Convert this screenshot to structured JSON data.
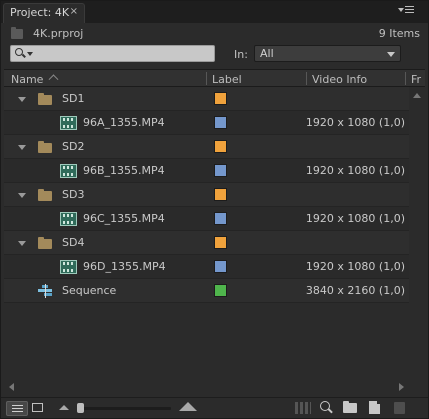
{
  "tab": {
    "title": "Project: 4K",
    "close": "×"
  },
  "project": {
    "filename": "4K.prproj",
    "item_count": "9 Items"
  },
  "search": {
    "value": "",
    "in_label": "In:",
    "in_value": "All"
  },
  "columns": {
    "name": "Name",
    "label": "Label",
    "video_info": "Video Info",
    "frame": "Fr"
  },
  "rows": [
    {
      "type": "folder",
      "name": "SD1",
      "label_color": "#f0a23c",
      "video_info": ""
    },
    {
      "type": "clip",
      "name": "96A_1355.MP4",
      "label_color": "#7497cc",
      "video_info": "1920 x 1080 (1,0)"
    },
    {
      "type": "folder",
      "name": "SD2",
      "label_color": "#f0a23c",
      "video_info": ""
    },
    {
      "type": "clip",
      "name": "96B_1355.MP4",
      "label_color": "#7497cc",
      "video_info": "1920 x 1080 (1,0)"
    },
    {
      "type": "folder",
      "name": "SD3",
      "label_color": "#f0a23c",
      "video_info": ""
    },
    {
      "type": "clip",
      "name": "96C_1355.MP4",
      "label_color": "#7497cc",
      "video_info": "1920 x 1080 (1,0)"
    },
    {
      "type": "folder",
      "name": "SD4",
      "label_color": "#f0a23c",
      "video_info": ""
    },
    {
      "type": "clip",
      "name": "96D_1355.MP4",
      "label_color": "#7497cc",
      "video_info": "1920 x 1080 (1,0)"
    },
    {
      "type": "sequence",
      "name": "Sequence",
      "label_color": "#4fb54c",
      "video_info": "3840 x 2160 (1,0)"
    }
  ],
  "toolbar": {
    "view_mode": "list-view",
    "zoom_level": 0,
    "icons": [
      "list-view-icon",
      "icon-view-icon",
      "zoom-out-icon",
      "zoom-in-icon",
      "automate-to-sequence-icon",
      "find-icon",
      "new-bin-icon",
      "new-item-icon",
      "clear-icon"
    ]
  }
}
